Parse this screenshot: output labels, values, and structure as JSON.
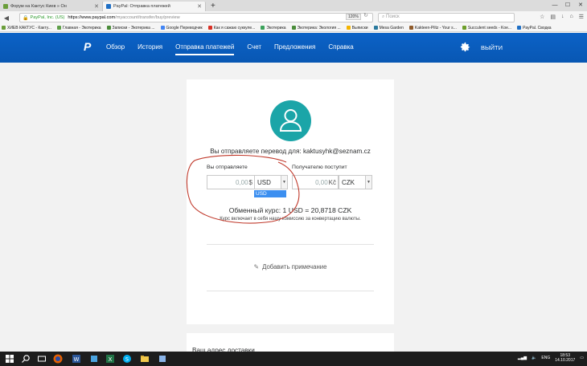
{
  "browser": {
    "tabs": [
      {
        "title": "Форум на Кактус Киев » Он",
        "active": false,
        "color": "#6a9e3a"
      },
      {
        "title": "PayPal: Отправка платежей",
        "active": true,
        "color": "#1f6fc5"
      }
    ],
    "url": {
      "org": "PayPal, Inc. (US)",
      "host": "https://www.paypal.com",
      "path": "/myaccount/transfer/buy/preview"
    },
    "zoom": "120%",
    "search_placeholder": "Поиск",
    "bookmarks": [
      "ХИЕВ КАКТУС - Какту...",
      "Главная - Экотерика",
      "Записки - Экотерика ...",
      "Google Переводчик",
      "Как я сажаю суккуле...",
      "Экотерика",
      "Экотерика: Экология ...",
      "Выписки",
      "Mesa Garden",
      "Kakteen-Piltz - Your s...",
      "Succulent seeds - Koe...",
      "PayPal. Сводка"
    ]
  },
  "paypal": {
    "nav": [
      "Обзор",
      "История",
      "Отправка платежей",
      "Счет",
      "Предложения",
      "Справка"
    ],
    "active_nav": "Отправка платежей",
    "logout": "ВЫЙТИ",
    "accent": "#0c62c7",
    "avatar_color": "#1ba5a8"
  },
  "transfer": {
    "recipient_text": "Вы отправляете перевод для: kaktusyhk@seznam.cz",
    "send_label": "Вы отправляете",
    "receive_label": "Получателю поступит",
    "send_amount": "0,00",
    "send_symbol": "$",
    "send_currency": "USD",
    "receive_amount": "0,00",
    "receive_symbol": "Kč",
    "receive_currency": "CZK",
    "dropdown_option": "USD",
    "rate_text": "Обменный курс: 1 USD = 20,8718 CZK",
    "rate_note": "Курс включает в себя нашу комиссию за конвертацию валюты.",
    "add_note": "Добавить примечание",
    "shipping_title": "Ваш адрес доставки"
  },
  "taskbar": {
    "lang": "ENG",
    "time": "18:53",
    "date": "14.10.2017"
  }
}
